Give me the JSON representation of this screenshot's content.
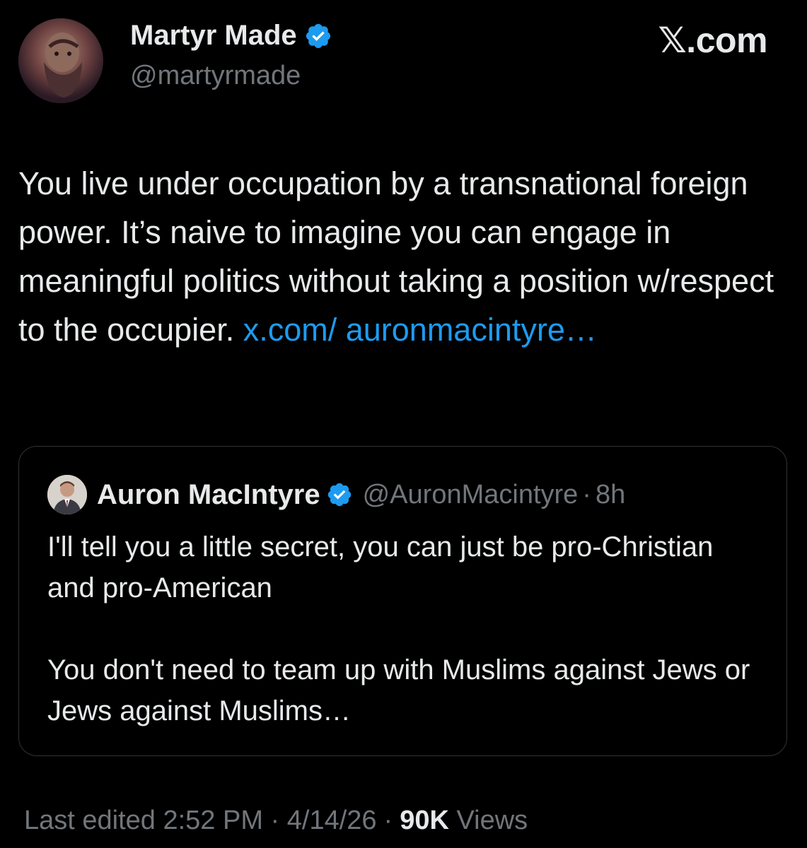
{
  "author": {
    "name": "Martyr Made",
    "handle": "@martyrmade",
    "verified": true
  },
  "brand": {
    "logo_text": "𝕏.com"
  },
  "tweet": {
    "text": "You live under occupation by a transnational foreign power. It’s naive to imagine you can engage in meaningful politics without taking a position w/respect to the occupier. ",
    "link_text": "x.com/ auronmacintyre…"
  },
  "quote": {
    "name": "Auron MacIntyre",
    "handle": "@AuronMacintyre",
    "separator": "·",
    "time": "8h",
    "verified": true,
    "paragraphs": [
      "I'll tell you a little secret, you can just be pro-Christian and pro-American",
      "You don't need to team up with Muslims against Jews or Jews against Muslims…"
    ]
  },
  "meta": {
    "edited_label": "Last edited 2:52 PM · 4/14/26",
    "separator": "·",
    "views_count": "90K",
    "views_label": "Views"
  },
  "colors": {
    "background": "#000000",
    "text": "#e7e9ea",
    "secondary": "#71767b",
    "link": "#1d9bf0",
    "border": "#2f3336"
  },
  "icons": {
    "avatar": "bearded-statue-avatar",
    "verified": "verified-badge-icon",
    "quote_avatar": "man-in-suit-avatar"
  }
}
